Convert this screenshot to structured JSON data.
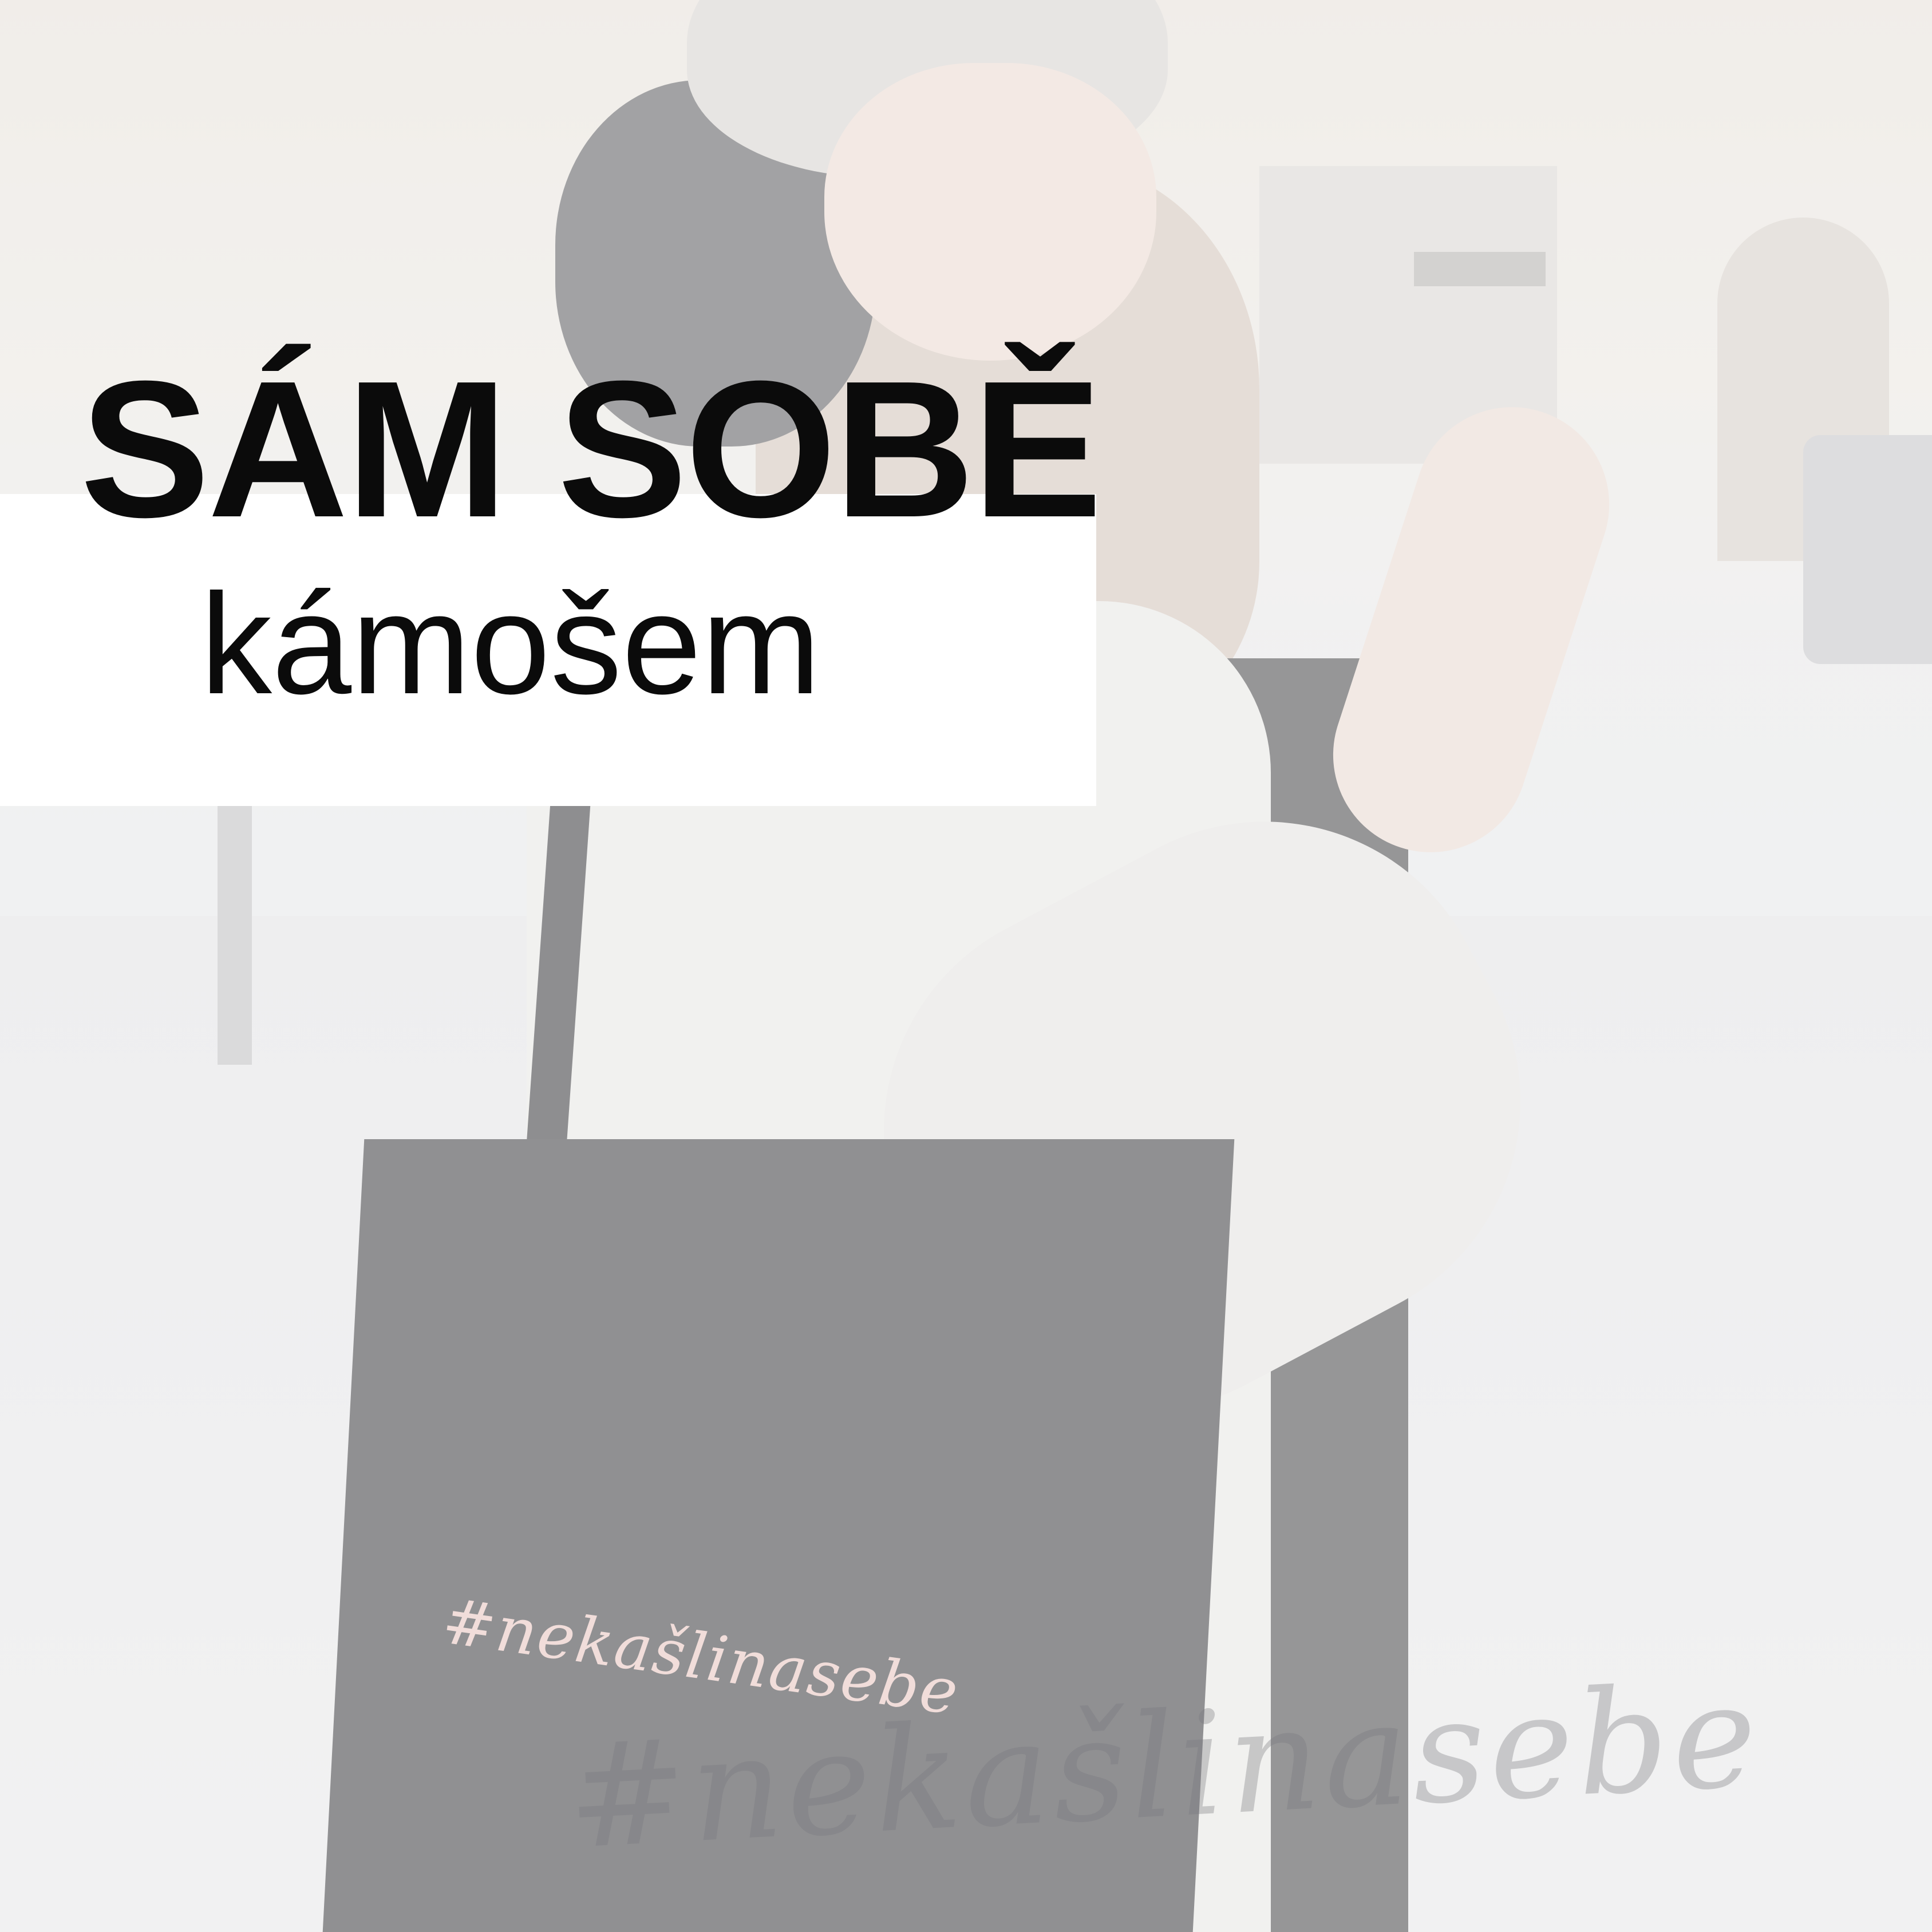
{
  "title": {
    "main": "SÁM SOBĚ",
    "sub": "kámošem"
  },
  "bag": {
    "print_text": "#nekašlinasebe"
  },
  "watermark": {
    "text": "#nekašlinasebe"
  },
  "colors": {
    "title_text": "#0b0b0b",
    "title_box": "#ffffff",
    "overlay": "rgba(255,255,255,0.38)",
    "bag": "#4d4d4f",
    "coat": "#e9e8e6"
  }
}
